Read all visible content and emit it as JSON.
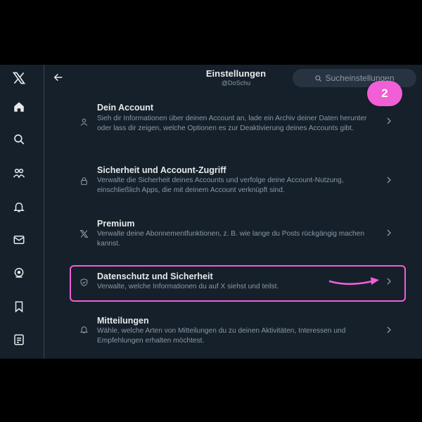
{
  "header": {
    "title": "Einstellungen",
    "handle": "@DoSchu",
    "search_placeholder": "Sucheinstellungen"
  },
  "annotation": {
    "step": "2",
    "color": "#f25ed6"
  },
  "sidebar": {
    "icons": [
      "x-logo-icon",
      "home-icon",
      "search-icon",
      "communities-icon",
      "notifications-icon",
      "messages-icon",
      "grok-icon",
      "bookmarks-icon",
      "lists-icon"
    ]
  },
  "settings": {
    "items": [
      {
        "title": "Dein Account",
        "description": "Sieh dir Informationen über deinen Account an, lade ein Archiv deiner Daten herunter oder lass dir zeigen, welche Optionen es zur Deaktivierung deines Accounts gibt.",
        "icon": "person-icon"
      },
      {
        "title": "Sicherheit und Account-Zugriff",
        "description": "Verwalte die Sicherheit deines Accounts und verfolge deine Account-Nutzung, einschließlich Apps, die mit deinem Account verknüpft sind.",
        "icon": "lock-icon"
      },
      {
        "title": "Premium",
        "description": "Verwalte deine Abonnementfunktionen, z. B. wie lange du Posts rückgängig machen kannst.",
        "icon": "x-icon"
      },
      {
        "title": "Datenschutz und Sicherheit",
        "description": "Verwalte, welche Informationen du auf X siehst und teilst.",
        "icon": "shield-icon"
      },
      {
        "title": "Mitteilungen",
        "description": "Wähle, welche Arten von Mitteilungen du zu deinen Aktivitäten, Interessen und Empfehlungen erhalten möchtest.",
        "icon": "bell-icon"
      }
    ]
  },
  "colors": {
    "background": "#15202b",
    "text": "#e7e9ea",
    "muted": "#8b98a5",
    "highlight": "#f25ed6"
  }
}
